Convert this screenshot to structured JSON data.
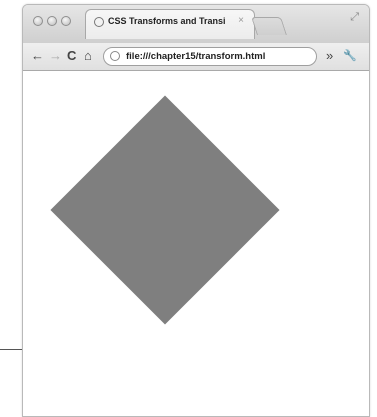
{
  "tab": {
    "title": "CSS Transforms and Transi",
    "close": "×"
  },
  "toolbar": {
    "back": "←",
    "forward": "→",
    "reload": "C",
    "home": "⌂",
    "url": "file:///chapter15/transform.html",
    "overflow": "»",
    "wrench": "🔧"
  },
  "colors": {
    "diamond": "#7f7f7f"
  }
}
